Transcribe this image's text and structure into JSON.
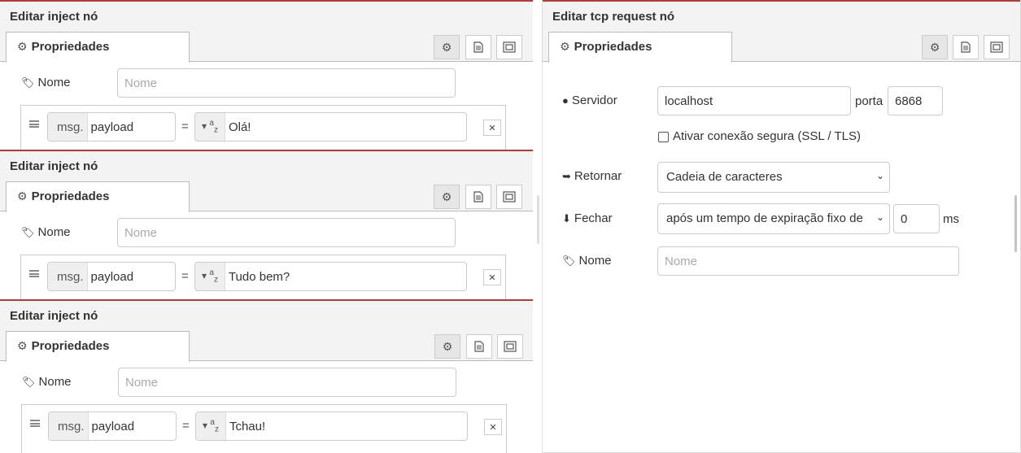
{
  "panels": [
    {
      "title": "Editar inject nó",
      "tab": "Propriedades",
      "name_label": "Nome",
      "name_placeholder": "Nome",
      "prop_prefix": "msg.",
      "prop_name": "payload",
      "equals": "=",
      "type_icon": "a z",
      "value": "Olá!"
    },
    {
      "title": "Editar inject nó",
      "tab": "Propriedades",
      "name_label": "Nome",
      "name_placeholder": "Nome",
      "prop_prefix": "msg.",
      "prop_name": "payload",
      "equals": "=",
      "type_icon": "a z",
      "value": "Tudo bem?"
    },
    {
      "title": "Editar inject nó",
      "tab": "Propriedades",
      "name_label": "Nome",
      "name_placeholder": "Nome",
      "prop_prefix": "msg.",
      "prop_name": "payload",
      "equals": "=",
      "type_icon": "a z",
      "value": "Tchau!"
    }
  ],
  "tcp": {
    "title": "Editar tcp request nó",
    "tab": "Propriedades",
    "server_label": "Servidor",
    "server_value": "localhost",
    "port_label": "porta",
    "port_value": "6868",
    "tls_label": "Ativar conexão segura (SSL / TLS)",
    "return_label": "Retornar",
    "return_value": "Cadeia de caracteres",
    "close_label": "Fechar",
    "close_value": "após um tempo de expiração fixo de",
    "close_timeout": "0",
    "close_unit": "ms",
    "name_label": "Nome",
    "name_placeholder": "Nome"
  },
  "icons": {
    "gear": "gear-icon",
    "description": "document-icon",
    "appearance": "frame-icon",
    "tag": "tag-icon",
    "globe": "globe-icon",
    "sign_in": "sign-in-icon",
    "download": "download-icon",
    "caret": "caret-down-icon",
    "close": "close-icon",
    "drag": "drag-handle-icon"
  },
  "colors": {
    "accent_line": "#b53a3a",
    "header_bg": "#f3f3f3"
  }
}
